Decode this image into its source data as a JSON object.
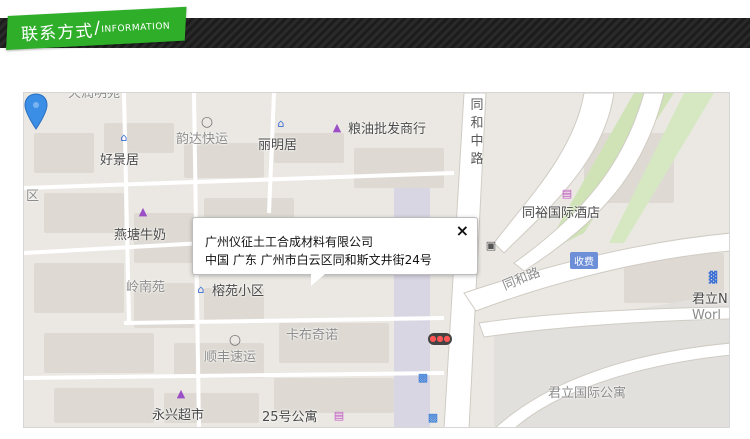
{
  "header": {
    "title_cn": "联系方式",
    "separator": "/",
    "title_en": "INFORMATION"
  },
  "map": {
    "labels": {
      "haojingju": "好景居",
      "yunda": "韵达快运",
      "liangmingju": "丽明居",
      "liangyou": "粮油批发商行",
      "qu": "区",
      "yantang": "燕塘牛奶",
      "lingnanyuan": "岭南苑",
      "rongyuan": "榕苑小区",
      "shunfeng": "顺丰速运",
      "kabuqinuo": "卡布奇诺",
      "yongxing": "永兴超市",
      "gongyu25": "25号公寓",
      "tongyu_hotel": "同裕国际酒店",
      "tonghe_road": "同和路",
      "tonghe_zhong_road": "同和中路",
      "toll": "收费",
      "junli_gongyu": "君立国际公寓",
      "junli_right": "君立N",
      "world_right": "Worl",
      "top_partial": "天润明苑"
    },
    "popup": {
      "company": "广州仪征土工合成材料有限公司",
      "address": "中国 广东 广州市白云区同和斯文井街24号",
      "close": "×"
    },
    "icons": {
      "marker": "location-pin-icon",
      "residential": "house-icon",
      "shop": "basket-icon",
      "hotel": "bed-icon",
      "bus": "bus-icon",
      "traffic_light": "traffic-light-icon",
      "car": "car-icon"
    },
    "colors": {
      "brand_green": "#2fae2a",
      "marker_blue": "#3a8ee6",
      "road_white": "#ffffff",
      "block_gray": "#dedad3",
      "green_belt": "#cfe3b6"
    }
  }
}
